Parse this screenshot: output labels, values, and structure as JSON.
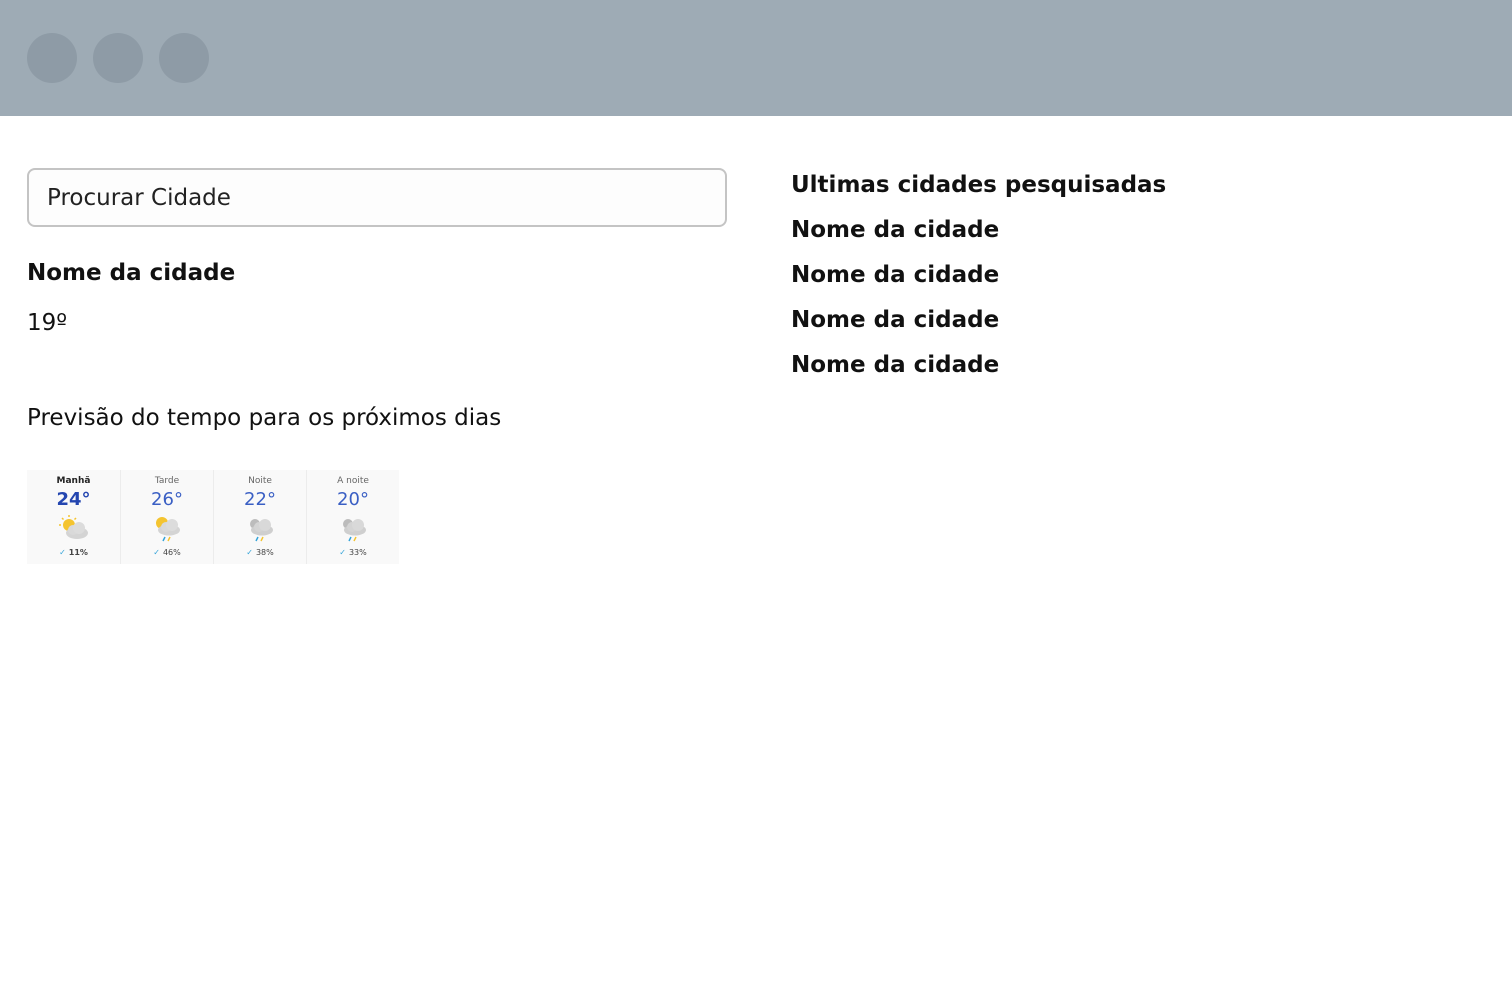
{
  "window": {
    "controls": [
      "window-dot",
      "window-dot",
      "window-dot"
    ]
  },
  "search": {
    "placeholder": "Procurar Cidade"
  },
  "current": {
    "city": "Nome da cidade",
    "temperature": "19º"
  },
  "forecast": {
    "title": "Previsão do tempo para os próximos dias",
    "periods": [
      {
        "label": "Manhã",
        "temp": "24°",
        "icon": "partly-sunny-icon",
        "rain": "11%"
      },
      {
        "label": "Tarde",
        "temp": "26°",
        "icon": "sun-cloud-rain-icon",
        "rain": "46%"
      },
      {
        "label": "Noite",
        "temp": "22°",
        "icon": "cloud-rain-icon",
        "rain": "38%"
      },
      {
        "label": "A noite",
        "temp": "20°",
        "icon": "cloud-rain-icon",
        "rain": "33%"
      }
    ]
  },
  "recent": {
    "title": "Ultimas cidades pesquisadas",
    "items": [
      {
        "label": "Nome da cidade"
      },
      {
        "label": "Nome da cidade"
      },
      {
        "label": "Nome da cidade"
      },
      {
        "label": "Nome da cidade"
      }
    ]
  },
  "colors": {
    "titlebar": "#9eabb5",
    "window_dot": "#8e9ba6",
    "temp_blue": "#3a5fc4",
    "rain_drop": "#33a3d9"
  }
}
